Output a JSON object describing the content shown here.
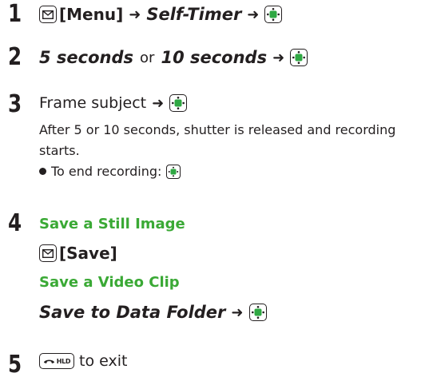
{
  "steps": [
    {
      "number": "1",
      "menu_label": "[Menu]",
      "target": "Self-Timer"
    },
    {
      "number": "2",
      "option_a": "5 seconds",
      "or": "or",
      "option_b": "10 seconds"
    },
    {
      "number": "3",
      "text": "Frame subject",
      "description": "After 5 or 10 seconds, shutter is released and recording starts.",
      "bullet": "To end recording:"
    },
    {
      "number": "4",
      "heading_still": "Save a Still Image",
      "save_label": "[Save]",
      "heading_video": "Save a Video Clip",
      "video_action": "Save to Data Folder"
    },
    {
      "number": "5",
      "exit_text": "to exit",
      "end_key_label": "HLD"
    }
  ],
  "colors": {
    "text": "#231f20",
    "accent_green": "#3aa935",
    "key_button_fill": "#2fa843"
  },
  "icons": [
    "mail-key-icon",
    "center-select-key-icon",
    "right-arrow-icon",
    "end-key-icon",
    "bullet-icon"
  ]
}
